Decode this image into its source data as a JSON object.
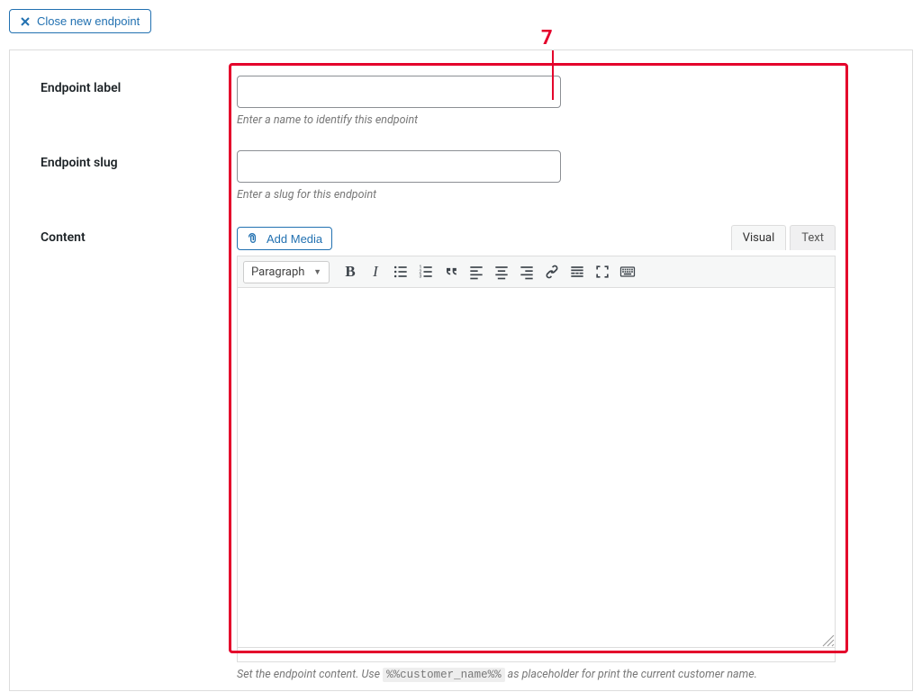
{
  "closeButton": {
    "label": "Close new endpoint"
  },
  "annotation": {
    "number": "7"
  },
  "fields": {
    "label": {
      "title": "Endpoint label",
      "help": "Enter a name to identify this endpoint",
      "value": ""
    },
    "slug": {
      "title": "Endpoint slug",
      "help": "Enter a slug for this endpoint",
      "value": ""
    },
    "content": {
      "title": "Content",
      "addMedia": "Add Media",
      "tabs": {
        "visual": "Visual",
        "text": "Text",
        "active": "visual"
      },
      "formatSelect": "Paragraph",
      "helpPrefix": "Set the endpoint content. Use ",
      "helpCode": "%%customer_name%%",
      "helpSuffix": " as placeholder for print the current customer name."
    }
  }
}
